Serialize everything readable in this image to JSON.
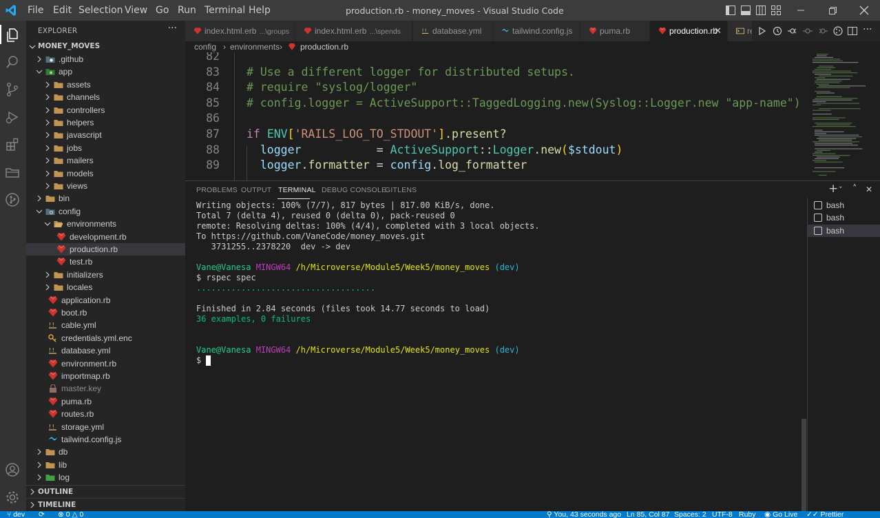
{
  "titlebar": {
    "menu": [
      "File",
      "Edit",
      "Selection",
      "View",
      "Go",
      "Run",
      "Terminal",
      "Help"
    ],
    "title": "production.rb - money_moves - Visual Studio Code"
  },
  "explorer": {
    "title": "EXPLORER",
    "more": "···",
    "root": "MONEY_MOVES",
    "items": [
      {
        "label": "github",
        "prefix": ".",
        "depth": 1,
        "kind": "folder",
        "open": false,
        "icon": "github-folder-icon"
      },
      {
        "label": "app",
        "depth": 1,
        "kind": "folder",
        "open": true,
        "icon": "app-folder-icon"
      },
      {
        "label": "assets",
        "depth": 2,
        "kind": "folder",
        "open": false,
        "icon": "folder-icon"
      },
      {
        "label": "channels",
        "depth": 2,
        "kind": "folder",
        "open": false,
        "icon": "folder-icon"
      },
      {
        "label": "controllers",
        "depth": 2,
        "kind": "folder",
        "open": false,
        "icon": "folder-icon"
      },
      {
        "label": "helpers",
        "depth": 2,
        "kind": "folder",
        "open": false,
        "icon": "folder-icon"
      },
      {
        "label": "javascript",
        "depth": 2,
        "kind": "folder",
        "open": false,
        "icon": "folder-icon"
      },
      {
        "label": "jobs",
        "depth": 2,
        "kind": "folder",
        "open": false,
        "icon": "folder-icon"
      },
      {
        "label": "mailers",
        "depth": 2,
        "kind": "folder",
        "open": false,
        "icon": "folder-icon"
      },
      {
        "label": "models",
        "depth": 2,
        "kind": "folder",
        "open": false,
        "icon": "folder-icon"
      },
      {
        "label": "views",
        "depth": 2,
        "kind": "folder",
        "open": false,
        "icon": "folder-icon"
      },
      {
        "label": "bin",
        "depth": 1,
        "kind": "folder",
        "open": false,
        "icon": "folder-icon"
      },
      {
        "label": "config",
        "depth": 1,
        "kind": "folder",
        "open": true,
        "icon": "config-folder-icon"
      },
      {
        "label": "environments",
        "depth": 2,
        "kind": "folder",
        "open": true,
        "icon": "folder-icon"
      },
      {
        "label": "development.rb",
        "depth": 3,
        "kind": "ruby",
        "icon": "ruby-icon"
      },
      {
        "label": "production.rb",
        "depth": 3,
        "kind": "ruby",
        "icon": "ruby-icon",
        "selected": true
      },
      {
        "label": "test.rb",
        "depth": 3,
        "kind": "ruby",
        "icon": "ruby-icon"
      },
      {
        "label": "initializers",
        "depth": 2,
        "kind": "folder",
        "open": false,
        "icon": "folder-icon"
      },
      {
        "label": "locales",
        "depth": 2,
        "kind": "folder",
        "open": false,
        "icon": "folder-icon"
      },
      {
        "label": "application.rb",
        "depth": 2,
        "kind": "ruby",
        "icon": "ruby-icon"
      },
      {
        "label": "boot.rb",
        "depth": 2,
        "kind": "ruby",
        "icon": "ruby-icon"
      },
      {
        "label": "cable.yml",
        "depth": 2,
        "kind": "yaml",
        "icon": "yaml-icon"
      },
      {
        "label": "credentials.yml.enc",
        "depth": 2,
        "kind": "key",
        "icon": "key-icon"
      },
      {
        "label": "database.yml",
        "depth": 2,
        "kind": "yaml",
        "icon": "yaml-icon"
      },
      {
        "label": "environment.rb",
        "depth": 2,
        "kind": "ruby",
        "icon": "ruby-icon"
      },
      {
        "label": "importmap.rb",
        "depth": 2,
        "kind": "ruby",
        "icon": "ruby-icon"
      },
      {
        "label": "master.key",
        "depth": 2,
        "kind": "lock",
        "icon": "lock-file-icon",
        "dim": true
      },
      {
        "label": "puma.rb",
        "depth": 2,
        "kind": "ruby",
        "icon": "ruby-icon"
      },
      {
        "label": "routes.rb",
        "depth": 2,
        "kind": "ruby",
        "icon": "ruby-icon"
      },
      {
        "label": "storage.yml",
        "depth": 2,
        "kind": "yaml",
        "icon": "yaml-icon"
      },
      {
        "label": "tailwind.config.js",
        "depth": 2,
        "kind": "tailwind",
        "icon": "tailwind-icon"
      },
      {
        "label": "db",
        "depth": 1,
        "kind": "folder",
        "open": false,
        "icon": "folder-icon"
      },
      {
        "label": "lib",
        "depth": 1,
        "kind": "folder",
        "open": false,
        "icon": "folder-icon"
      },
      {
        "label": "log",
        "depth": 1,
        "kind": "folder",
        "open": false,
        "icon": "log-folder-icon"
      }
    ],
    "outline": "OUTLINE",
    "timeline": "TIMELINE"
  },
  "tabs": [
    {
      "label": "index.html.erb",
      "desc": "...\\groups",
      "icon": "erb-icon"
    },
    {
      "label": "index.html.erb",
      "desc": "...\\spends",
      "icon": "erb-icon"
    },
    {
      "label": "database.yml",
      "desc": "",
      "icon": "yaml-icon"
    },
    {
      "label": "tailwind.config.js",
      "desc": "",
      "icon": "tailwind-icon"
    },
    {
      "label": "puma.rb",
      "desc": "",
      "icon": "ruby-icon"
    },
    {
      "label": "production.rb",
      "desc": "",
      "icon": "ruby-icon",
      "active": true,
      "close": "✕"
    },
    {
      "label": "re",
      "desc": "",
      "icon": "readme-icon"
    }
  ],
  "breadcrumb": [
    "config",
    "environments",
    "production.rb"
  ],
  "breadcrumb_sep": "›",
  "editor": {
    "lines": [
      {
        "n": "82",
        "tokens": []
      },
      {
        "n": "83",
        "tokens": [
          {
            "t": "# Use a different logger for distributed setups.",
            "c": "comment"
          }
        ]
      },
      {
        "n": "84",
        "tokens": [
          {
            "t": "# require \"syslog/logger\"",
            "c": "comment"
          }
        ]
      },
      {
        "n": "85",
        "tokens": [
          {
            "t": "# config.logger = ActiveSupport::TaggedLogging.new(Syslog::Logger.new \"app-name\")",
            "c": "comment"
          }
        ]
      },
      {
        "n": "86",
        "tokens": []
      },
      {
        "n": "87",
        "tokens": [
          {
            "t": "if ",
            "c": "kw"
          },
          {
            "t": "ENV",
            "c": "const"
          },
          {
            "t": "[",
            "c": "gold"
          },
          {
            "t": "'RAILS_LOG_TO_STDOUT'",
            "c": "str"
          },
          {
            "t": "]",
            "c": "gold"
          },
          {
            "t": ".present?",
            "c": "fn"
          }
        ]
      },
      {
        "n": "88",
        "tokens": [
          {
            "t": "  logger",
            "c": "var"
          },
          {
            "t": "           = ",
            "c": "plain"
          },
          {
            "t": "ActiveSupport",
            "c": "const"
          },
          {
            "t": "::",
            "c": "plain"
          },
          {
            "t": "Logger",
            "c": "const"
          },
          {
            "t": ".",
            "c": "plain"
          },
          {
            "t": "new",
            "c": "fn"
          },
          {
            "t": "(",
            "c": "gold"
          },
          {
            "t": "$stdout",
            "c": "var"
          },
          {
            "t": ")",
            "c": "gold"
          }
        ]
      },
      {
        "n": "89",
        "tokens": [
          {
            "t": "  logger",
            "c": "var"
          },
          {
            "t": ".",
            "c": "plain"
          },
          {
            "t": "formatter",
            "c": "fn"
          },
          {
            "t": " = ",
            "c": "plain"
          },
          {
            "t": "config",
            "c": "var"
          },
          {
            "t": ".",
            "c": "plain"
          },
          {
            "t": "log_formatter",
            "c": "fn"
          }
        ]
      }
    ]
  },
  "panel": {
    "tabs": [
      "PROBLEMS",
      "OUTPUT",
      "TERMINAL",
      "DEBUG CONSOLE",
      "GITLENS"
    ],
    "active_tab": "TERMINAL",
    "actions": {
      "add": "+",
      "split": "˅",
      "maximize": "˄",
      "close": "✕"
    },
    "terminals": [
      "bash",
      "bash",
      "bash"
    ]
  },
  "terminal": {
    "lines": [
      {
        "segs": [
          {
            "t": "Writing objects: 100% (7/7), 817 bytes | 817.00 KiB/s, done.",
            "c": ""
          }
        ]
      },
      {
        "segs": [
          {
            "t": "Total 7 (delta 4), reused 0 (delta 0), pack-reused 0",
            "c": ""
          }
        ]
      },
      {
        "segs": [
          {
            "t": "remote: Resolving deltas: 100% (4/4), completed with 3 local objects.",
            "c": ""
          }
        ]
      },
      {
        "segs": [
          {
            "t": "To https://github.com/VaneCode/money_moves.git",
            "c": ""
          }
        ]
      },
      {
        "segs": [
          {
            "t": "   3731255..2378220  dev -> dev",
            "c": ""
          }
        ]
      },
      {
        "segs": []
      },
      {
        "segs": [
          {
            "t": "Vane@Vanesa ",
            "c": "green"
          },
          {
            "t": "MINGW64 ",
            "c": "magenta"
          },
          {
            "t": "/h/Microverse/Module5/Week5/money_moves ",
            "c": "yellow"
          },
          {
            "t": "(dev)",
            "c": "cyan"
          }
        ]
      },
      {
        "segs": [
          {
            "t": "$ rspec spec",
            "c": ""
          }
        ]
      },
      {
        "segs": [
          {
            "t": "....................................",
            "c": "teal"
          }
        ]
      },
      {
        "segs": []
      },
      {
        "segs": [
          {
            "t": "Finished in 2.84 seconds (files took 14.77 seconds to load)",
            "c": ""
          }
        ]
      },
      {
        "segs": [
          {
            "t": "36 examples, 0 failures",
            "c": "teal"
          }
        ]
      },
      {
        "segs": []
      },
      {
        "segs": []
      },
      {
        "segs": [
          {
            "t": "Vane@Vanesa ",
            "c": "green"
          },
          {
            "t": "MINGW64 ",
            "c": "magenta"
          },
          {
            "t": "/h/Microverse/Module5/Week5/money_moves ",
            "c": "yellow"
          },
          {
            "t": "(dev)",
            "c": "cyan"
          }
        ]
      },
      {
        "segs": [
          {
            "t": "$ ",
            "c": ""
          }
        ],
        "cursor": true
      }
    ]
  },
  "statusbar": {
    "branch": "dev",
    "errors": "0",
    "warnings": "0",
    "blame": "You, 43 seconds ago",
    "position": "Ln 85, Col 87",
    "spaces": "Spaces: 2",
    "encoding": "UTF-8",
    "language": "Ruby",
    "golive": "Go Live",
    "prettier": "Prettier"
  },
  "colors": {
    "accent": "#007acc",
    "ruby": "#cc342d",
    "folder": "#c09553",
    "yaml": "#e5c07b",
    "tailwind": "#38bdf8"
  }
}
